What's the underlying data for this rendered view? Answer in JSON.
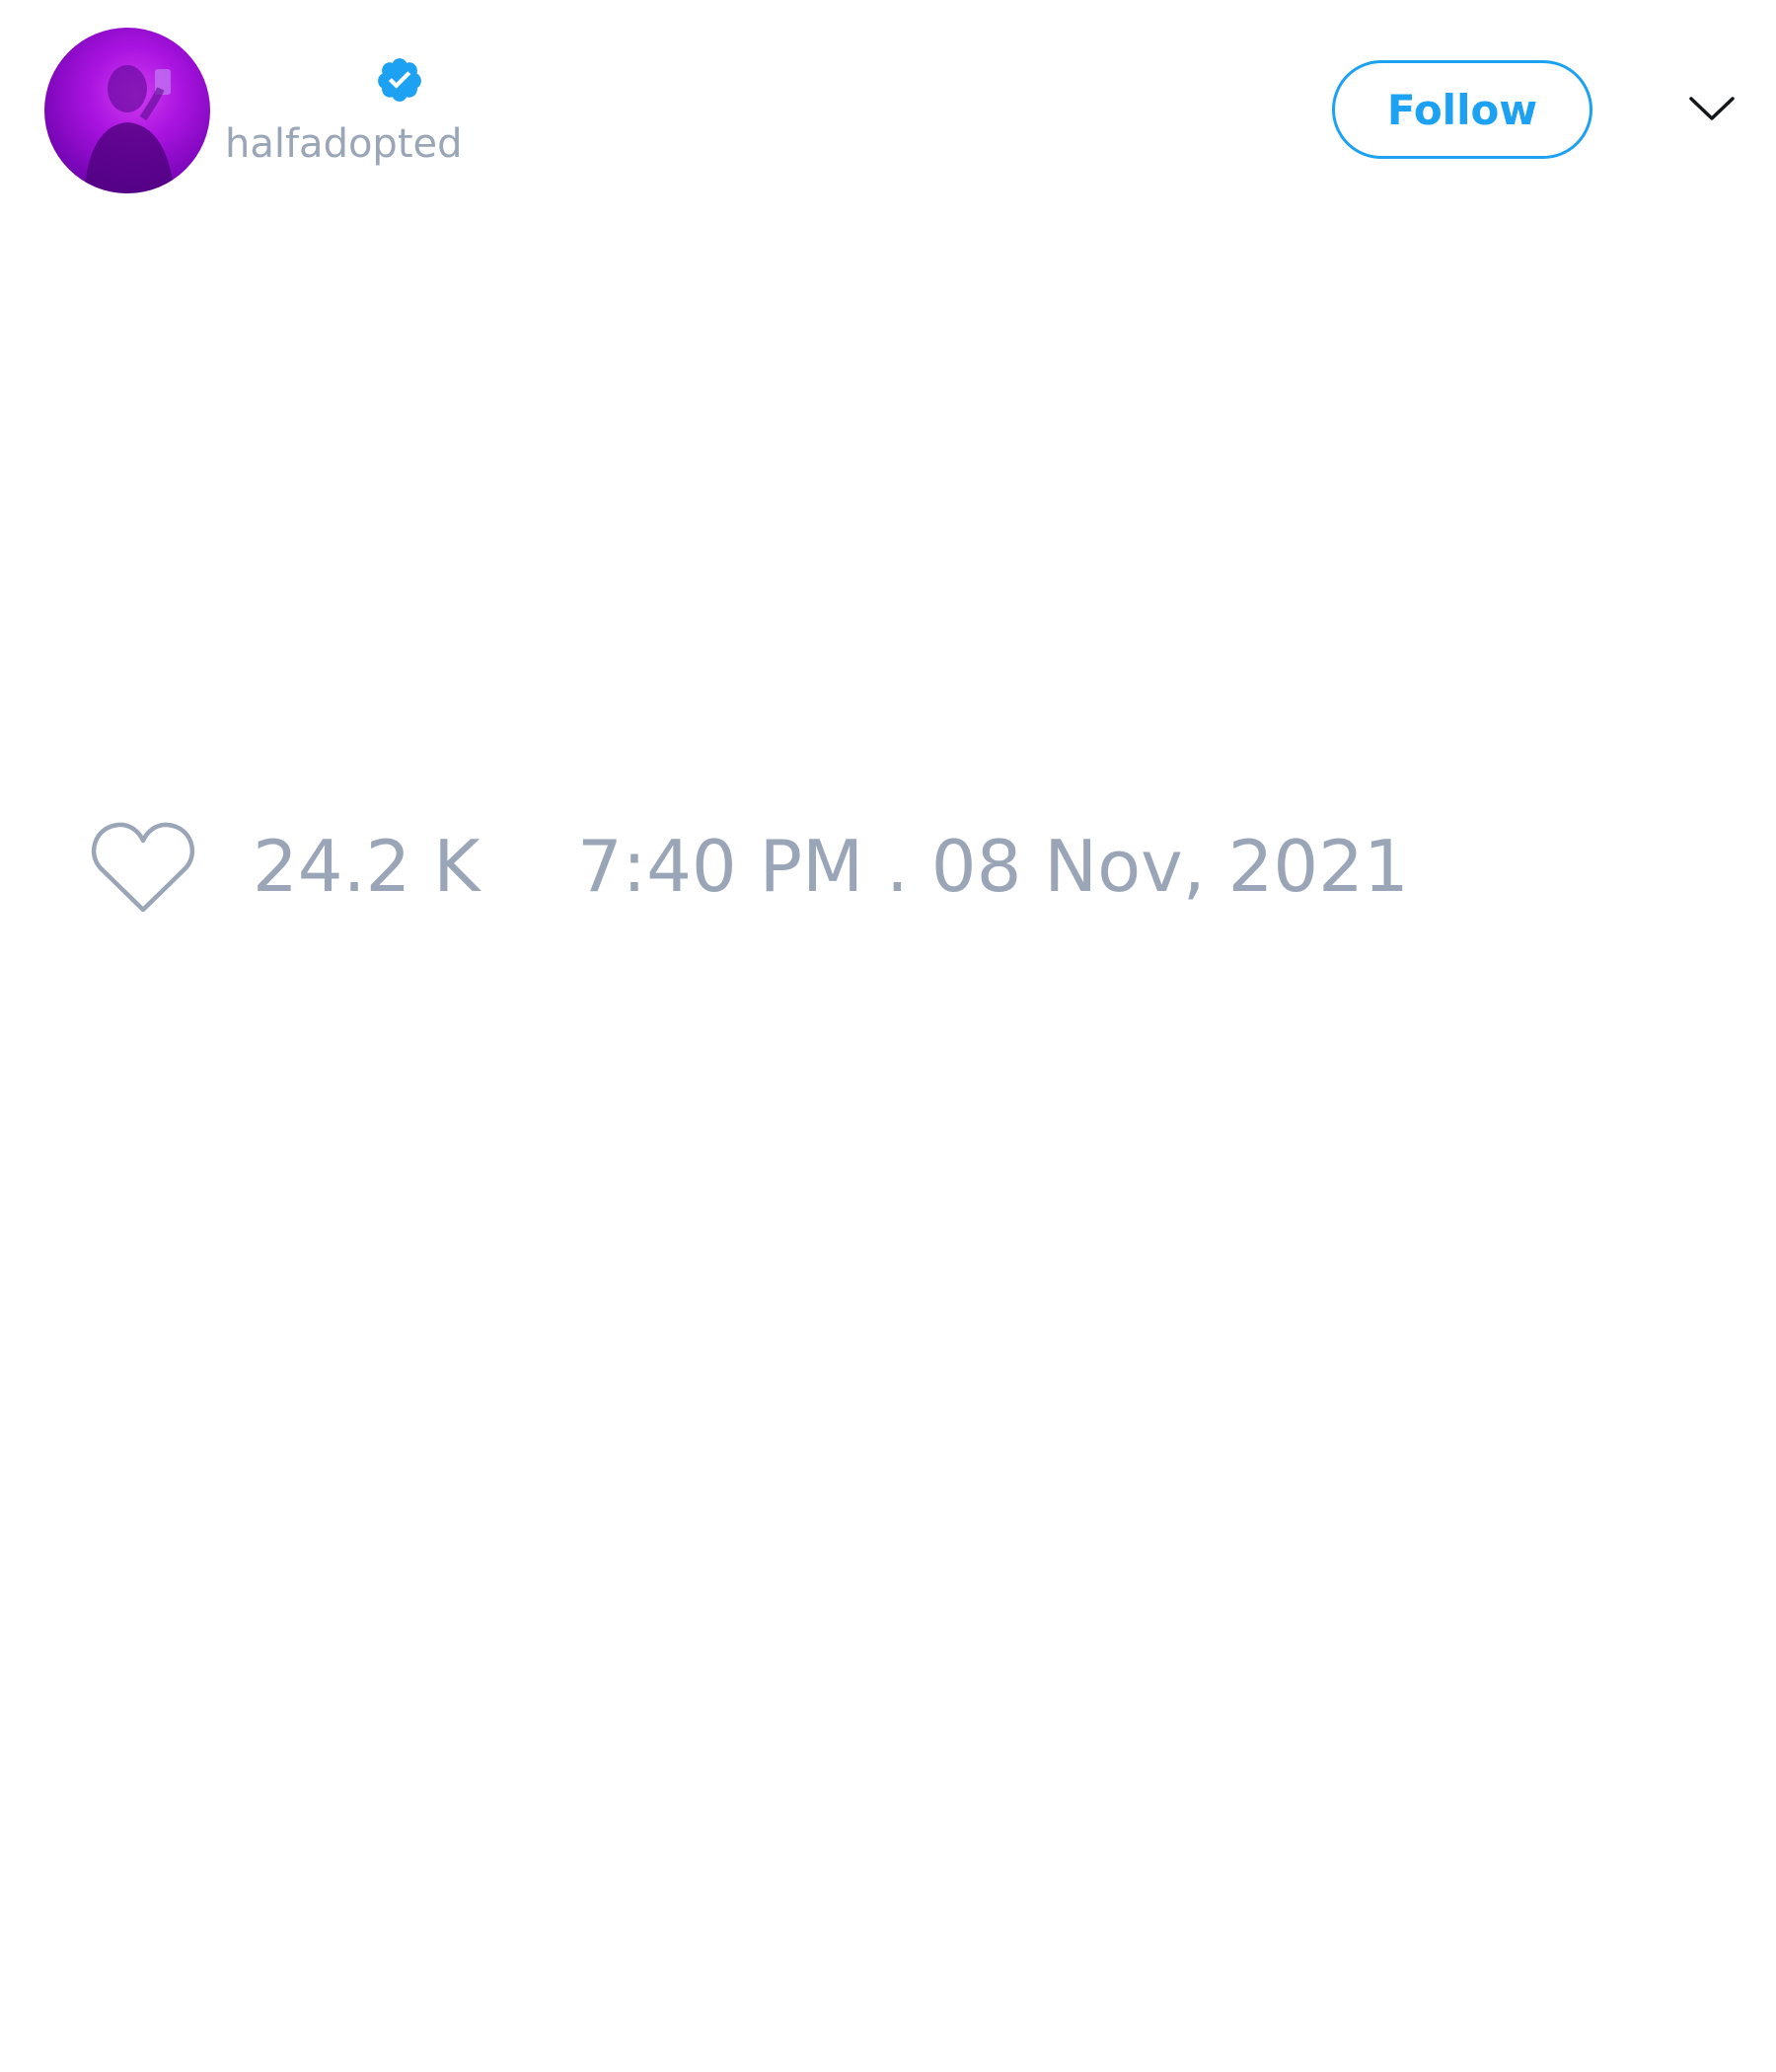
{
  "tweet": {
    "author": {
      "display_name": "",
      "handle": "halfadopted",
      "verified": true,
      "avatar_icon": "avatar-photo"
    },
    "follow_label": "Follow",
    "menu_icon": "chevron-down-icon",
    "likes": {
      "icon": "heart-icon",
      "count": "24.2 K"
    },
    "timestamp": "7:40 PM . 08 Nov, 2021"
  },
  "colors": {
    "accent": "#1da1f2",
    "muted_text": "#9aa6b7",
    "avatar_purple": "#a913e0"
  }
}
